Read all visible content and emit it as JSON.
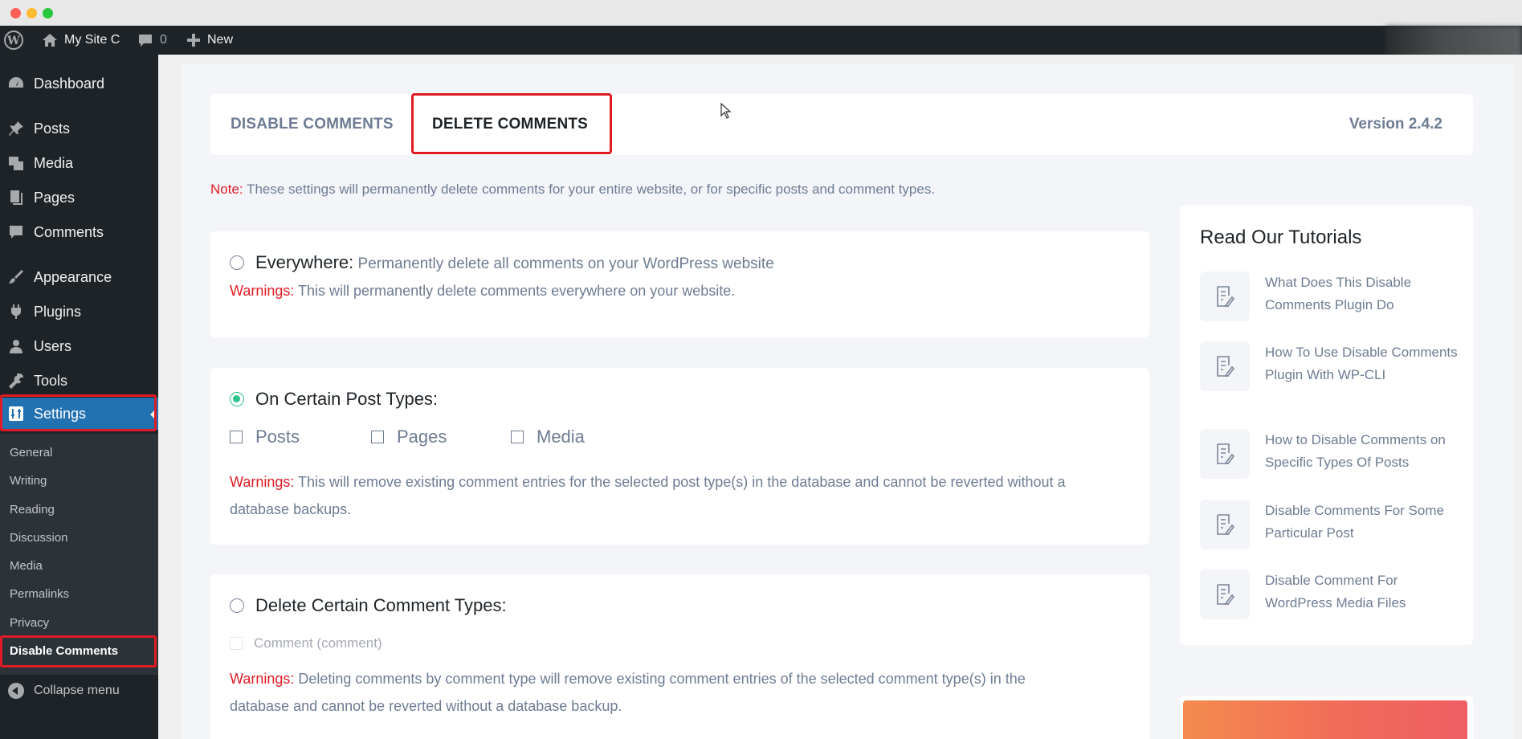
{
  "adminbar": {
    "site_name": "My Site C",
    "comments_count": "0",
    "new_label": "New"
  },
  "sidebar": {
    "items": [
      {
        "label": "Dashboard",
        "icon": "dashboard-icon"
      },
      {
        "label": "Posts",
        "icon": "pin-icon"
      },
      {
        "label": "Media",
        "icon": "media-icon"
      },
      {
        "label": "Pages",
        "icon": "pages-icon"
      },
      {
        "label": "Comments",
        "icon": "comment-icon"
      },
      {
        "label": "Appearance",
        "icon": "brush-icon"
      },
      {
        "label": "Plugins",
        "icon": "plug-icon"
      },
      {
        "label": "Users",
        "icon": "user-icon"
      },
      {
        "label": "Tools",
        "icon": "wrench-icon"
      },
      {
        "label": "Settings",
        "icon": "settings-icon"
      }
    ],
    "submenu": [
      "General",
      "Writing",
      "Reading",
      "Discussion",
      "Media",
      "Permalinks",
      "Privacy",
      "Disable Comments"
    ],
    "collapse_label": "Collapse menu"
  },
  "tabs": {
    "disable": "DISABLE COMMENTS",
    "delete": "DELETE COMMENTS",
    "version": "Version 2.4.2"
  },
  "note": {
    "label": "Note:",
    "text": " These settings will permanently delete comments for your entire website, or for specific posts and comment types."
  },
  "options": {
    "everywhere": {
      "title": "Everywhere:",
      "desc": " Permanently delete all comments on your WordPress website",
      "warn_label": "Warnings:",
      "warn_text": " This will permanently delete comments everywhere on your website."
    },
    "post_types": {
      "title": "On Certain Post Types:",
      "checkboxes": [
        "Posts",
        "Pages",
        "Media"
      ],
      "warn_label": "Warnings:",
      "warn_text": " This will remove existing comment entries for the selected post type(s) in the database and cannot be reverted without a database backups."
    },
    "comment_types": {
      "title": "Delete Certain Comment Types:",
      "checkbox": "Comment (comment)",
      "warn_label": "Warnings:",
      "warn_text": " Deleting comments by comment type will remove existing comment entries of the selected comment type(s) in the database and cannot be reverted without a database backup."
    }
  },
  "tutorials": {
    "title": "Read Our Tutorials",
    "items": [
      "What Does This Disable Comments Plugin Do",
      "How To Use Disable Comments Plugin With WP-CLI",
      "How to Disable Comments on Specific Types Of Posts",
      "Disable Comments For Some Particular Post",
      "Disable Comment For WordPress Media Files"
    ]
  }
}
